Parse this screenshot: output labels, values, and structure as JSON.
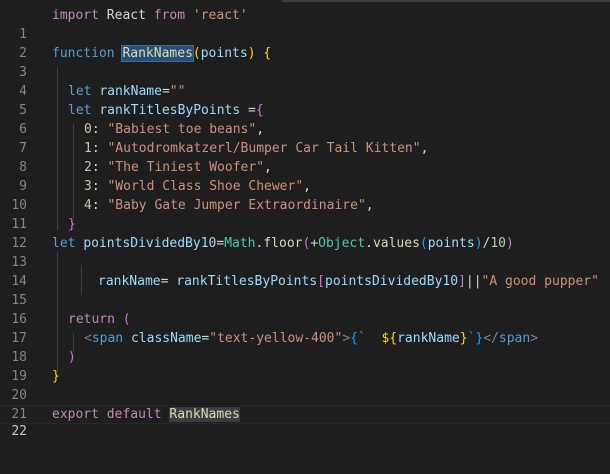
{
  "editor": {
    "lines": [
      {
        "n": "1"
      },
      {
        "n": "2"
      },
      {
        "n": "3"
      },
      {
        "n": "4"
      },
      {
        "n": "5"
      },
      {
        "n": "6"
      },
      {
        "n": "7"
      },
      {
        "n": "8"
      },
      {
        "n": "9"
      },
      {
        "n": "10"
      },
      {
        "n": "11"
      },
      {
        "n": "12"
      },
      {
        "n": "13"
      },
      {
        "n": "14"
      },
      {
        "n": "15"
      },
      {
        "n": "16"
      },
      {
        "n": "17"
      },
      {
        "n": "18"
      },
      {
        "n": "19"
      },
      {
        "n": "20"
      },
      {
        "n": "21"
      },
      {
        "n": "22"
      }
    ],
    "code": {
      "l1": {
        "kw": "import",
        "name": " React ",
        "from": "from",
        "str": " 'react'"
      },
      "l3": {
        "kw": "function",
        "fn": "RankNames",
        "param": "points",
        "open": "(",
        "close": ")",
        "brace": "{"
      },
      "l5": {
        "kw": "let",
        "var": "rankName",
        "eq": "=",
        "str": "\"\""
      },
      "l6": {
        "kw": "let",
        "var": "rankTitlesByPoints",
        "eq": " =",
        "brace": "{"
      },
      "l7": {
        "key": "0",
        "str": "\"Babiest toe beans\"",
        "comma": ","
      },
      "l8": {
        "key": "1",
        "str": "\"Autodromkatzerl/Bumper Car Tail Kitten\"",
        "comma": ","
      },
      "l9": {
        "key": "2",
        "str": "\"The Tiniest Woofer\"",
        "comma": ","
      },
      "l10": {
        "key": "3",
        "str": "\"World Class Shoe Chewer\"",
        "comma": ","
      },
      "l11": {
        "key": "4",
        "str": "\"Baby Gate Jumper Extraordinaire\"",
        "comma": ","
      },
      "l12": {
        "brace": "}"
      },
      "l13": {
        "kw": "let",
        "var": "pointsDividedBy10",
        "eq": "=",
        "obj": "Math",
        "fn": "floor",
        "plus": "+",
        "obj2": "Object",
        "fn2": "values",
        "param": "points",
        "div": "/",
        "num": "10"
      },
      "l15": {
        "var": "rankName",
        "eq": "= ",
        "var2": "rankTitlesByPoints",
        "idx": "pointsDividedBy10",
        "or": "||",
        "str": "\"A good pupper\""
      },
      "l17": {
        "kw": "return",
        "paren": "("
      },
      "l18": {
        "tag": "span",
        "attr": "className",
        "eq": "=",
        "str": "\"text-yellow-400\"",
        "tmpl_open": "{`",
        "expr": "${",
        "var": "rankName",
        "expr_close": "}",
        "tmpl_close": "`}",
        "close_tag": "span"
      },
      "l19": {
        "paren": ")"
      },
      "l20": {
        "brace": "}"
      },
      "l22": {
        "kw": "export",
        "kw2": "default",
        "name": "RankNames"
      }
    }
  }
}
